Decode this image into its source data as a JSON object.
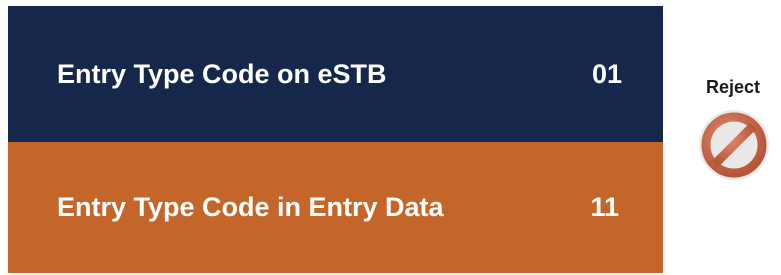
{
  "colors": {
    "top_panel_bg": "#15284b",
    "bottom_panel_bg": "#c4662a",
    "reject_icon": "#c8684a"
  },
  "rows": [
    {
      "label": "Entry Type Code on eSTB",
      "code": "01"
    },
    {
      "label": "Entry Type Code in Entry Data",
      "code": "11"
    }
  ],
  "status": {
    "label": "Reject",
    "icon": "prohibition-icon"
  }
}
